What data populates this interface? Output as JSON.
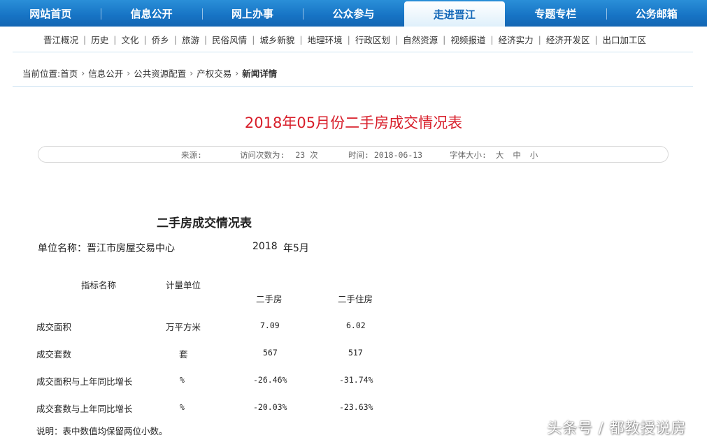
{
  "topnav": {
    "items": [
      {
        "label": "网站首页"
      },
      {
        "label": "信息公开"
      },
      {
        "label": "网上办事"
      },
      {
        "label": "公众参与"
      },
      {
        "label": "走进晋江"
      },
      {
        "label": "专题专栏"
      },
      {
        "label": "公务邮箱"
      }
    ],
    "active_index": 4
  },
  "subnav": {
    "items": [
      "晋江概况",
      "历史",
      "文化",
      "侨乡",
      "旅游",
      "民俗风情",
      "城乡新貌",
      "地理环境",
      "行政区划",
      "自然资源",
      "视频报道",
      "经济实力",
      "经济开发区",
      "出口加工区"
    ],
    "separator": "|"
  },
  "breadcrumb": {
    "prefix": "当前位置:",
    "items": [
      "首页",
      "信息公开",
      "公共资源配置",
      "产权交易",
      "新闻详情"
    ]
  },
  "article": {
    "title": "2018年05月份二手房成交情况表",
    "meta": {
      "source_label": "来源:",
      "visits_label": "访问次数为:",
      "visits_value": "23 次",
      "time_label": "时间:",
      "time_value": "2018-06-13",
      "font_size_label": "字体大小:",
      "font_sizes": [
        "大",
        "中",
        "小"
      ]
    }
  },
  "table": {
    "heading": "二手房成交情况表",
    "unit_name": "单位名称：晋江市房屋交易中心",
    "year": "2018",
    "month": "年5月",
    "header": {
      "indicator": "指标名称",
      "unit": "计量单位",
      "col1": "二手房",
      "col2": "二手住房"
    },
    "rows": [
      {
        "name": "成交面积",
        "unit": "万平方米",
        "v1": "7.09",
        "v2": "6.02"
      },
      {
        "name": "成交套数",
        "unit": "套",
        "v1": "567",
        "v2": "517"
      },
      {
        "name": "成交面积与上年同比增长",
        "unit": "%",
        "v1": "-26.46%",
        "v2": "-31.74%"
      },
      {
        "name": "成交套数与上年同比增长",
        "unit": "%",
        "v1": "-20.03%",
        "v2": "-23.63%"
      }
    ],
    "note": "说明：表中数值均保留两位小数。"
  },
  "watermark": "头条号 / 都教授说房"
}
